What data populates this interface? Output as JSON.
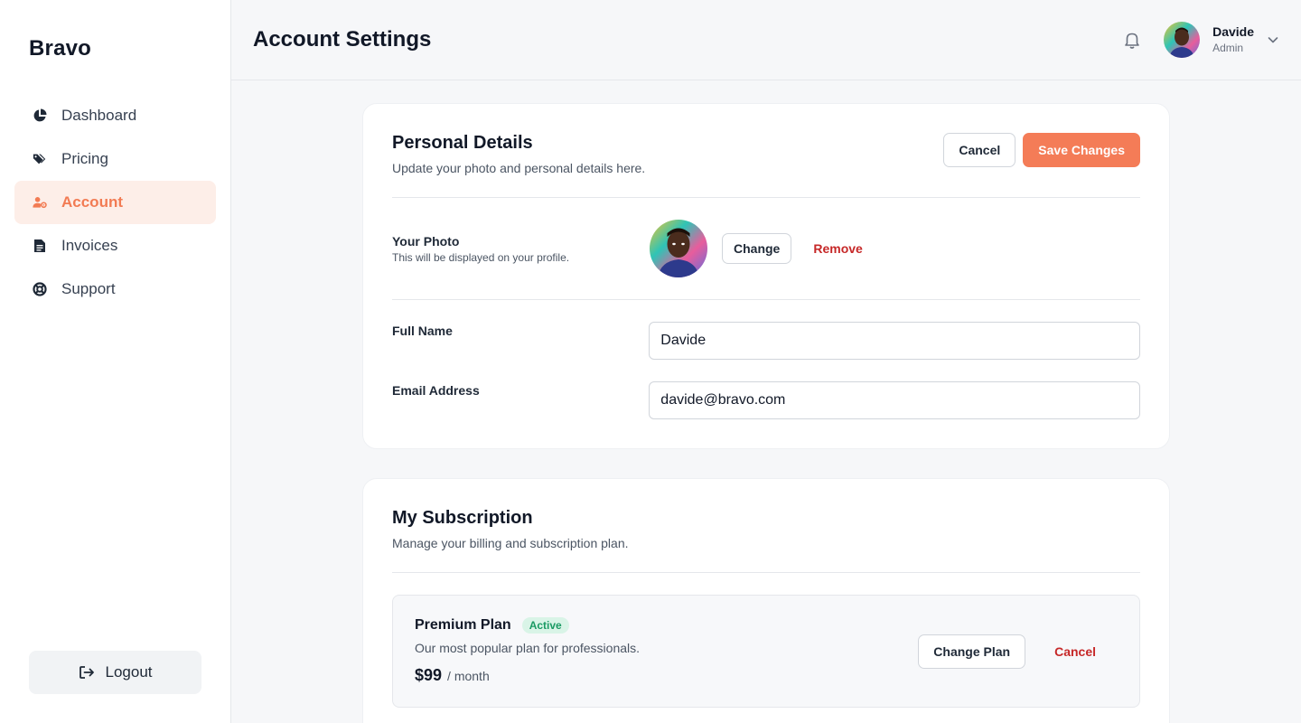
{
  "brand": "Bravo",
  "sidebar": {
    "items": [
      {
        "label": "Dashboard",
        "icon": "pie-chart-icon"
      },
      {
        "label": "Pricing",
        "icon": "tags-icon"
      },
      {
        "label": "Account",
        "icon": "user-gear-icon",
        "active": true
      },
      {
        "label": "Invoices",
        "icon": "document-icon"
      },
      {
        "label": "Support",
        "icon": "life-ring-icon"
      }
    ],
    "logout_label": "Logout"
  },
  "header": {
    "title": "Account Settings",
    "user_name": "Davide",
    "user_role": "Admin"
  },
  "personal": {
    "title": "Personal Details",
    "subtitle": "Update your photo and personal details here.",
    "cancel_label": "Cancel",
    "save_label": "Save Changes",
    "photo_label": "Your Photo",
    "photo_sub": "This will be displayed on your profile.",
    "change_label": "Change",
    "remove_label": "Remove",
    "full_name_label": "Full Name",
    "full_name_value": "Davide",
    "email_label": "Email Address",
    "email_value": "davide@bravo.com"
  },
  "subscription": {
    "title": "My Subscription",
    "subtitle": "Manage your billing and subscription plan.",
    "plan_name": "Premium Plan",
    "plan_status": "Active",
    "plan_desc": "Our most popular plan for professionals.",
    "price": "$99",
    "period": "/ month",
    "change_plan_label": "Change Plan",
    "cancel_label": "Cancel"
  },
  "colors": {
    "accent": "#f47c57",
    "active_bg": "#fdeee8",
    "danger": "#c62828",
    "success": "#1a9a63"
  }
}
